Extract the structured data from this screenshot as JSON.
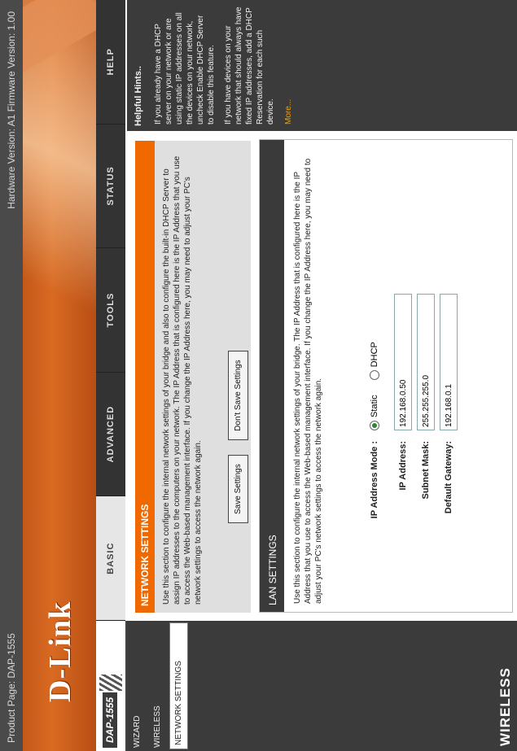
{
  "infobar": {
    "product": "Product Page: DAP-1555",
    "versions": "Hardware Version: A1   Firmware Version: 1.00"
  },
  "brand": {
    "logo": "D-Link",
    "model": "DAP-1555",
    "footer": "WIRELESS"
  },
  "tabs": [
    {
      "label": "BASIC",
      "active": true
    },
    {
      "label": "ADVANCED",
      "active": false
    },
    {
      "label": "TOOLS",
      "active": false
    },
    {
      "label": "STATUS",
      "active": false
    },
    {
      "label": "HELP",
      "active": false
    }
  ],
  "leftnav": {
    "items": [
      "WIZARD",
      "WIRELESS",
      "NETWORK SETTINGS"
    ],
    "selected_index": 2
  },
  "network_settings": {
    "title": "NETWORK SETTINGS",
    "text": "Use this section to configure the internal network settings of your bridge and also to configure the built-in DHCP Server to assign IP addresses to the computers on your network. The IP Address that is configured here is the IP Address that you use to access the Web-based management interface. If you change the IP Address here, you may need to adjust your PC's network settings to access the network again.",
    "save_label": "Save Settings",
    "dont_save_label": "Don't Save Settings"
  },
  "lan_settings": {
    "title": "LAN SETTINGS",
    "text": "Use this section to configure the internal network settings of your bridge. The IP Address that is configured here is the IP Address that you use to access the Web-based management interface. If you change the IP Address here, you may need to adjust your PC's network settings to access the network again.",
    "ip_mode_label": "IP Address Mode :",
    "static_label": "Static",
    "dhcp_label": "DHCP",
    "mode": "Static",
    "ip_label": "IP Address:",
    "ip_value": "192.168.0.50",
    "mask_label": "Subnet Mask:",
    "mask_value": "255.255.255.0",
    "gw_label": "Default Gateway:",
    "gw_value": "192.168.0.1"
  },
  "help": {
    "title": "Helpful Hints..",
    "p1": "If you already have a DHCP server on your network or are using static IP addresses on all the devices on your network, uncheck Enable DHCP Server to disable this feature.",
    "p2": "If you have devices on your network that should always have fixed IP addresses, add a DHCP Reservation for each such device.",
    "more": "More..."
  }
}
